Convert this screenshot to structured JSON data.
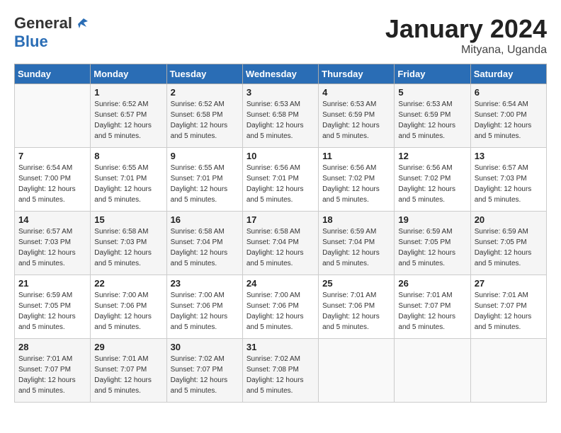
{
  "header": {
    "logo_line1": "General",
    "logo_line2": "Blue",
    "month_title": "January 2024",
    "location": "Mityana, Uganda"
  },
  "weekdays": [
    "Sunday",
    "Monday",
    "Tuesday",
    "Wednesday",
    "Thursday",
    "Friday",
    "Saturday"
  ],
  "weeks": [
    [
      {
        "day": "",
        "info": ""
      },
      {
        "day": "1",
        "info": "Sunrise: 6:52 AM\nSunset: 6:57 PM\nDaylight: 12 hours\nand 5 minutes."
      },
      {
        "day": "2",
        "info": "Sunrise: 6:52 AM\nSunset: 6:58 PM\nDaylight: 12 hours\nand 5 minutes."
      },
      {
        "day": "3",
        "info": "Sunrise: 6:53 AM\nSunset: 6:58 PM\nDaylight: 12 hours\nand 5 minutes."
      },
      {
        "day": "4",
        "info": "Sunrise: 6:53 AM\nSunset: 6:59 PM\nDaylight: 12 hours\nand 5 minutes."
      },
      {
        "day": "5",
        "info": "Sunrise: 6:53 AM\nSunset: 6:59 PM\nDaylight: 12 hours\nand 5 minutes."
      },
      {
        "day": "6",
        "info": "Sunrise: 6:54 AM\nSunset: 7:00 PM\nDaylight: 12 hours\nand 5 minutes."
      }
    ],
    [
      {
        "day": "7",
        "info": "Sunrise: 6:54 AM\nSunset: 7:00 PM\nDaylight: 12 hours\nand 5 minutes."
      },
      {
        "day": "8",
        "info": "Sunrise: 6:55 AM\nSunset: 7:01 PM\nDaylight: 12 hours\nand 5 minutes."
      },
      {
        "day": "9",
        "info": "Sunrise: 6:55 AM\nSunset: 7:01 PM\nDaylight: 12 hours\nand 5 minutes."
      },
      {
        "day": "10",
        "info": "Sunrise: 6:56 AM\nSunset: 7:01 PM\nDaylight: 12 hours\nand 5 minutes."
      },
      {
        "day": "11",
        "info": "Sunrise: 6:56 AM\nSunset: 7:02 PM\nDaylight: 12 hours\nand 5 minutes."
      },
      {
        "day": "12",
        "info": "Sunrise: 6:56 AM\nSunset: 7:02 PM\nDaylight: 12 hours\nand 5 minutes."
      },
      {
        "day": "13",
        "info": "Sunrise: 6:57 AM\nSunset: 7:03 PM\nDaylight: 12 hours\nand 5 minutes."
      }
    ],
    [
      {
        "day": "14",
        "info": "Sunrise: 6:57 AM\nSunset: 7:03 PM\nDaylight: 12 hours\nand 5 minutes."
      },
      {
        "day": "15",
        "info": "Sunrise: 6:58 AM\nSunset: 7:03 PM\nDaylight: 12 hours\nand 5 minutes."
      },
      {
        "day": "16",
        "info": "Sunrise: 6:58 AM\nSunset: 7:04 PM\nDaylight: 12 hours\nand 5 minutes."
      },
      {
        "day": "17",
        "info": "Sunrise: 6:58 AM\nSunset: 7:04 PM\nDaylight: 12 hours\nand 5 minutes."
      },
      {
        "day": "18",
        "info": "Sunrise: 6:59 AM\nSunset: 7:04 PM\nDaylight: 12 hours\nand 5 minutes."
      },
      {
        "day": "19",
        "info": "Sunrise: 6:59 AM\nSunset: 7:05 PM\nDaylight: 12 hours\nand 5 minutes."
      },
      {
        "day": "20",
        "info": "Sunrise: 6:59 AM\nSunset: 7:05 PM\nDaylight: 12 hours\nand 5 minutes."
      }
    ],
    [
      {
        "day": "21",
        "info": "Sunrise: 6:59 AM\nSunset: 7:05 PM\nDaylight: 12 hours\nand 5 minutes."
      },
      {
        "day": "22",
        "info": "Sunrise: 7:00 AM\nSunset: 7:06 PM\nDaylight: 12 hours\nand 5 minutes."
      },
      {
        "day": "23",
        "info": "Sunrise: 7:00 AM\nSunset: 7:06 PM\nDaylight: 12 hours\nand 5 minutes."
      },
      {
        "day": "24",
        "info": "Sunrise: 7:00 AM\nSunset: 7:06 PM\nDaylight: 12 hours\nand 5 minutes."
      },
      {
        "day": "25",
        "info": "Sunrise: 7:01 AM\nSunset: 7:06 PM\nDaylight: 12 hours\nand 5 minutes."
      },
      {
        "day": "26",
        "info": "Sunrise: 7:01 AM\nSunset: 7:07 PM\nDaylight: 12 hours\nand 5 minutes."
      },
      {
        "day": "27",
        "info": "Sunrise: 7:01 AM\nSunset: 7:07 PM\nDaylight: 12 hours\nand 5 minutes."
      }
    ],
    [
      {
        "day": "28",
        "info": "Sunrise: 7:01 AM\nSunset: 7:07 PM\nDaylight: 12 hours\nand 5 minutes."
      },
      {
        "day": "29",
        "info": "Sunrise: 7:01 AM\nSunset: 7:07 PM\nDaylight: 12 hours\nand 5 minutes."
      },
      {
        "day": "30",
        "info": "Sunrise: 7:02 AM\nSunset: 7:07 PM\nDaylight: 12 hours\nand 5 minutes."
      },
      {
        "day": "31",
        "info": "Sunrise: 7:02 AM\nSunset: 7:08 PM\nDaylight: 12 hours\nand 5 minutes."
      },
      {
        "day": "",
        "info": ""
      },
      {
        "day": "",
        "info": ""
      },
      {
        "day": "",
        "info": ""
      }
    ]
  ]
}
